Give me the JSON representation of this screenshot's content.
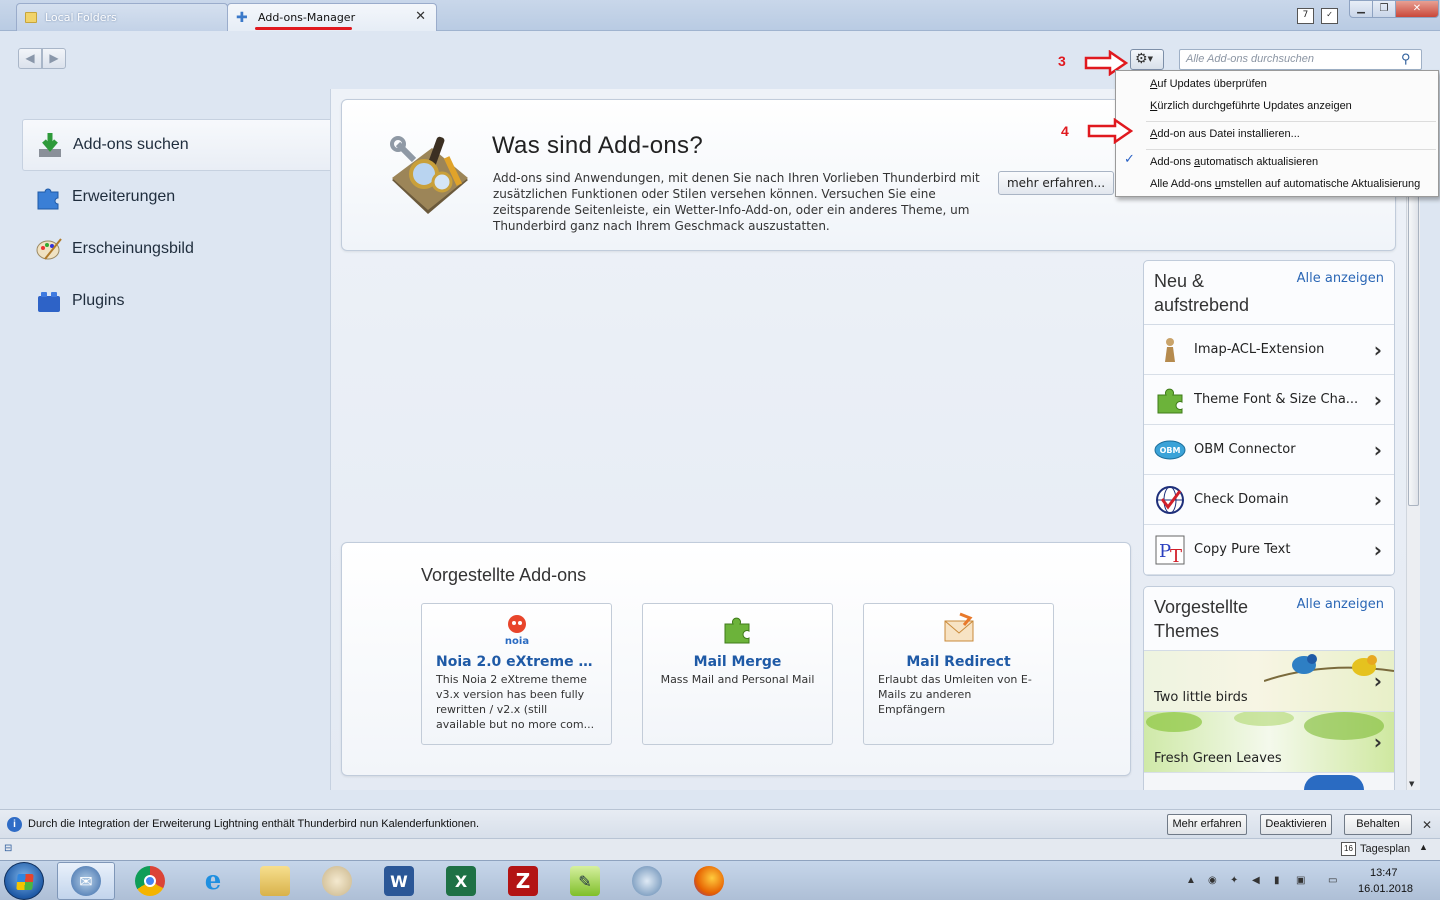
{
  "tabs": [
    {
      "label": "Local Folders"
    },
    {
      "label": "Add-ons-Manager"
    }
  ],
  "annotations": {
    "step3": "3",
    "step4": "4",
    "accent": "#e0191f"
  },
  "search": {
    "placeholder": "Alle Add-ons durchsuchen"
  },
  "sidebar": {
    "items": [
      {
        "label": "Add-ons suchen",
        "icon": "download-icon",
        "active": true
      },
      {
        "label": "Erweiterungen",
        "icon": "puzzle-icon"
      },
      {
        "label": "Erscheinungsbild",
        "icon": "palette-icon"
      },
      {
        "label": "Plugins",
        "icon": "lego-block-icon"
      }
    ]
  },
  "intro": {
    "title": "Was sind Add-ons?",
    "text": "Add-ons sind Anwendungen, mit denen Sie nach Ihren Vorlieben Thunderbird mit zusätzlichen Funktionen oder Stilen versehen können. Versuchen Sie eine zeitsparende Seitenleiste, ein Wetter-Info-Add-on, oder ein anderes Theme, um Thunderbird ganz nach Ihrem Geschmack auszustatten.",
    "button": "mehr erfahren..."
  },
  "featured": {
    "title": "Vorgestellte Add-ons",
    "cards": [
      {
        "name": "Noia 2.0 eXtreme (v...",
        "desc": "This Noia 2 eXtreme theme v3.x version has been fully rewritten / v2.x (still available but no more com...",
        "icon": "noia-icon"
      },
      {
        "name": "Mail Merge",
        "desc": "Mass Mail and Personal Mail",
        "icon": "puzzle-icon"
      },
      {
        "name": "Mail Redirect",
        "desc": "Erlaubt das Umleiten von E-Mails zu anderen Empfängern",
        "icon": "envelope-icon"
      }
    ]
  },
  "new_panel": {
    "title": "Neu & aufstrebend",
    "link": "Alle anzeigen",
    "items": [
      {
        "name": "Imap-ACL-Extension",
        "icon": "pawn-icon"
      },
      {
        "name": "Theme Font & Size Cha...",
        "icon": "puzzle-icon"
      },
      {
        "name": "OBM Connector",
        "icon": "obm-icon"
      },
      {
        "name": "Check Domain",
        "icon": "globe-check-icon"
      },
      {
        "name": "Copy Pure Text",
        "icon": "pt-icon"
      }
    ]
  },
  "themes_panel": {
    "title": "Vorgestellte Themes",
    "link": "Alle anzeigen",
    "items": [
      {
        "name": "Two little birds"
      },
      {
        "name": "Fresh Green Leaves"
      }
    ]
  },
  "gear_menu": {
    "items": [
      {
        "label": "Auf Updates überprüfen"
      },
      {
        "label": "Kürzlich durchgeführte Updates anzeigen"
      },
      {
        "label": "Add-on aus Datei installieren..."
      },
      {
        "label": "Add-ons automatisch aktualisieren",
        "checked": true
      },
      {
        "label": "Alle Add-ons umstellen auf automatische Aktualisierung"
      }
    ]
  },
  "notification": {
    "text": "Durch die Integration der Erweiterung Lightning enthält Thunderbird nun Kalenderfunktionen.",
    "buttons": [
      "Mehr erfahren",
      "Deaktivieren",
      "Behalten"
    ]
  },
  "statusbar": {
    "today_pane": "Tagesplan",
    "cal_day": "16"
  },
  "taskbar": {
    "apps": [
      "thunderbird",
      "chrome",
      "internet-explorer",
      "file-explorer",
      "paint",
      "word",
      "excel",
      "filezilla",
      "notepad-plus",
      "network-app",
      "firefox"
    ],
    "time": "13:47",
    "date": "16.01.2018"
  }
}
